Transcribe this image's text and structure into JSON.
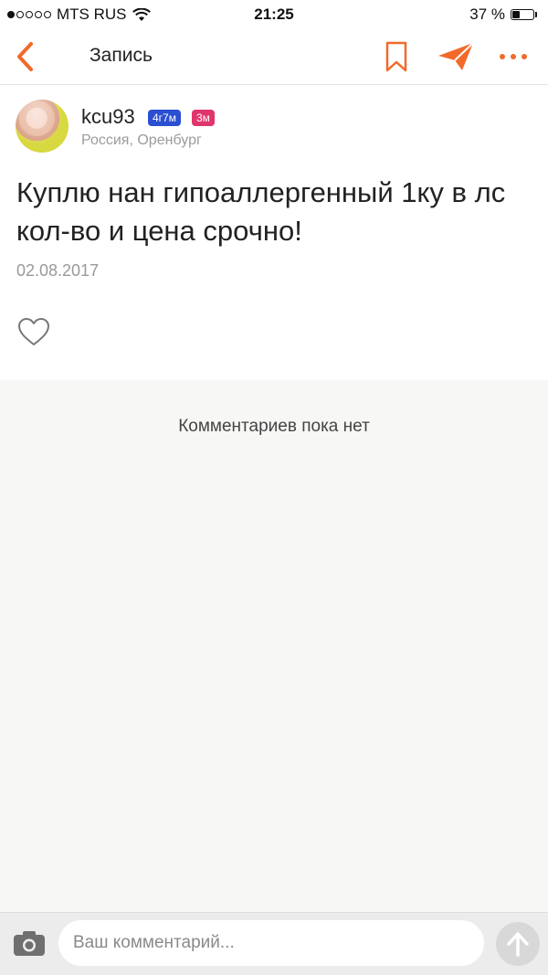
{
  "status_bar": {
    "carrier": "MTS RUS",
    "time": "21:25",
    "battery_percent": "37 %",
    "battery_level": 0.37
  },
  "nav": {
    "title": "Запись",
    "accent_color": "#f26a2a"
  },
  "post": {
    "author": {
      "username": "kcu93",
      "badges": [
        "4г7м",
        "3м"
      ],
      "location": "Россия, Оренбург"
    },
    "text": "Куплю нан гипоаллергенный 1ку в лс кол-во и цена срочно!",
    "date": "02.08.2017"
  },
  "comments": {
    "empty_text": "Комментариев пока нет"
  },
  "composer": {
    "placeholder": "Ваш комментарий..."
  }
}
